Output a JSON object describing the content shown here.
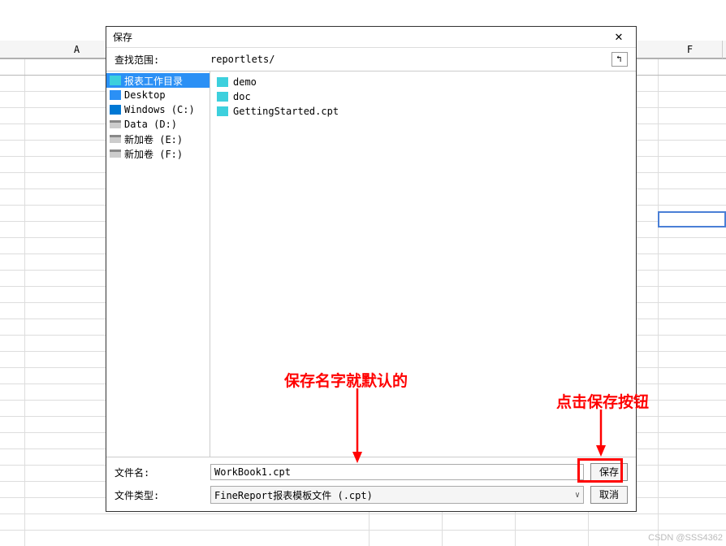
{
  "spreadsheet": {
    "col_a": "A",
    "col_f": "F"
  },
  "dialog": {
    "title": "保存",
    "path_label": "查找范围:",
    "path_value": "reportlets/",
    "sidebar": [
      {
        "name": "报表工作目录",
        "icon": "folder-cyan",
        "selected": true
      },
      {
        "name": "Desktop",
        "icon": "folder-blue",
        "selected": false
      },
      {
        "name": "Windows (C:)",
        "icon": "win-icon",
        "selected": false
      },
      {
        "name": "Data (D:)",
        "icon": "disk-icon",
        "selected": false
      },
      {
        "name": "新加卷 (E:)",
        "icon": "disk-icon",
        "selected": false
      },
      {
        "name": "新加卷 (F:)",
        "icon": "disk-icon",
        "selected": false
      }
    ],
    "files": [
      {
        "name": "demo",
        "icon": "folder-cyan"
      },
      {
        "name": "doc",
        "icon": "folder-cyan"
      },
      {
        "name": "GettingStarted.cpt",
        "icon": "cpt-icon"
      }
    ],
    "filename_label": "文件名:",
    "filename_value": "WorkBook1.cpt",
    "filetype_label": "文件类型:",
    "filetype_value": "FineReport报表模板文件 (.cpt)",
    "save_btn": "保存",
    "cancel_btn": "取消"
  },
  "annotations": {
    "a1": "保存名字就默认的",
    "a2": "点击保存按钮"
  },
  "watermark": "CSDN @SSS4362"
}
